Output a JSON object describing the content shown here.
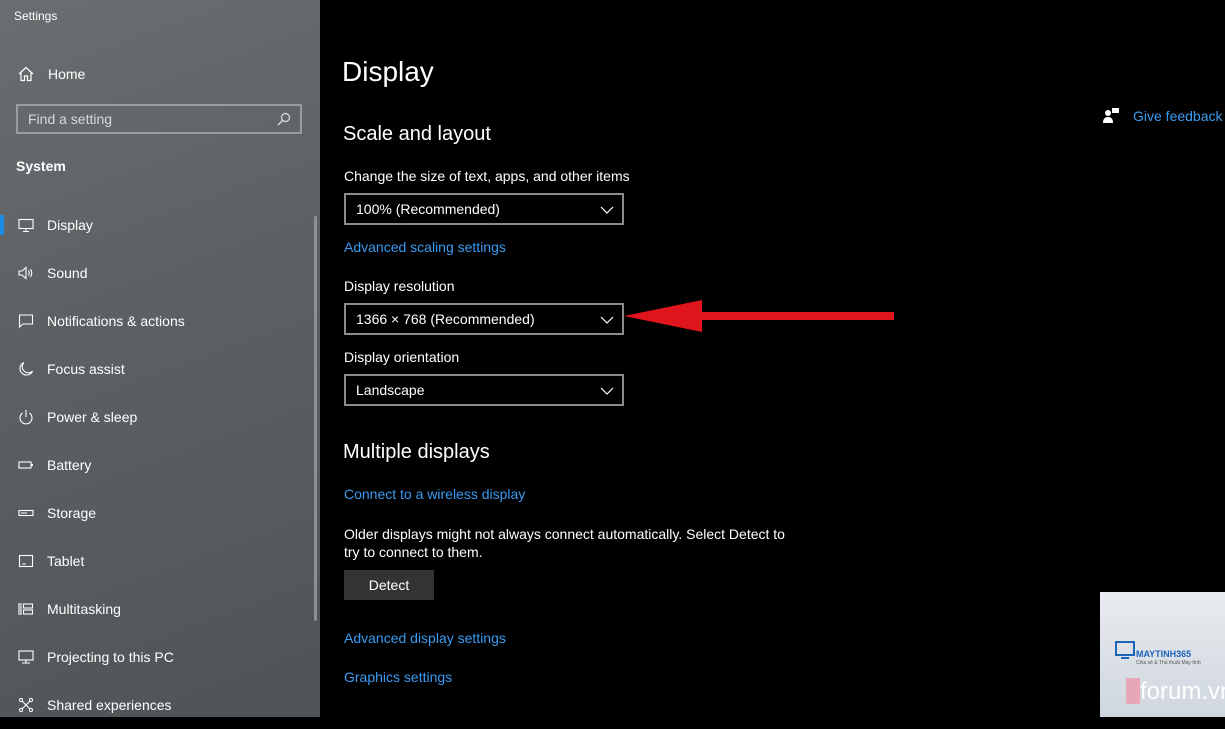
{
  "window": {
    "title": "Settings"
  },
  "sidebar": {
    "home_label": "Home",
    "search_placeholder": "Find a setting",
    "section": "System",
    "items": [
      {
        "label": "Display",
        "icon": "monitor-icon",
        "active": true
      },
      {
        "label": "Sound",
        "icon": "speaker-icon"
      },
      {
        "label": "Notifications & actions",
        "icon": "notification-icon"
      },
      {
        "label": "Focus assist",
        "icon": "moon-icon"
      },
      {
        "label": "Power & sleep",
        "icon": "power-icon"
      },
      {
        "label": "Battery",
        "icon": "battery-icon"
      },
      {
        "label": "Storage",
        "icon": "storage-icon"
      },
      {
        "label": "Tablet",
        "icon": "tablet-icon"
      },
      {
        "label": "Multitasking",
        "icon": "multitasking-icon"
      },
      {
        "label": "Projecting to this PC",
        "icon": "projector-icon"
      },
      {
        "label": "Shared experiences",
        "icon": "shared-icon"
      }
    ]
  },
  "main": {
    "title": "Display",
    "feedback": "Give feedback",
    "scale_section": "Scale and layout",
    "scale_label": "Change the size of text, apps, and other items",
    "scale_value": "100% (Recommended)",
    "advanced_scaling": "Advanced scaling settings",
    "resolution_label": "Display resolution",
    "resolution_value": "1366 × 768 (Recommended)",
    "orientation_label": "Display orientation",
    "orientation_value": "Landscape",
    "multiple_section": "Multiple displays",
    "connect_wireless": "Connect to a wireless display",
    "older_displays_text": "Older displays might not always connect automatically. Select Detect to try to connect to them.",
    "detect_button": "Detect",
    "advanced_display": "Advanced display settings",
    "graphics_settings": "Graphics settings"
  },
  "watermark": {
    "brand": "MAYTINH365",
    "tagline": "Chia sẻ & Thủ thuật Máy tính",
    "site": "forum.vn"
  },
  "colors": {
    "accent": "#1a8ce6",
    "link": "#3a9bf0",
    "arrow": "#e0141c"
  }
}
